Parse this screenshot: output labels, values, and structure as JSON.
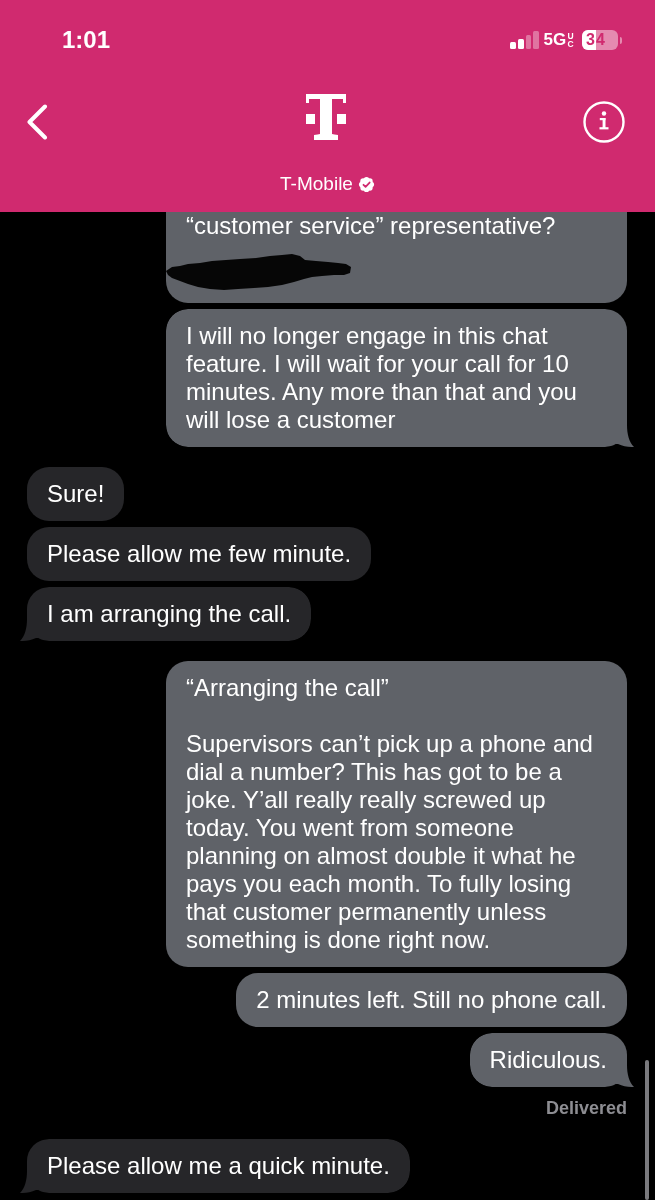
{
  "status_bar": {
    "time": "1:01",
    "network": "5G",
    "network_badge": "UC",
    "battery": "34"
  },
  "header": {
    "contact_name": "T-Mobile",
    "verified": true
  },
  "messages": [
    {
      "kind": "sent",
      "text": "“customer service” representative?",
      "redacted": true,
      "tail": false
    },
    {
      "kind": "sent",
      "text": "I will no longer engage in this chat feature. I will wait for your call for 10 minutes. Any more than that and you will lose a customer",
      "redacted": false,
      "tail": true
    },
    {
      "kind": "received",
      "text": "Sure!",
      "redacted": false,
      "tail": false
    },
    {
      "kind": "received",
      "text": "Please allow me few minute.",
      "redacted": false,
      "tail": false
    },
    {
      "kind": "received",
      "text": "I am arranging the call.",
      "redacted": false,
      "tail": true
    },
    {
      "kind": "sent",
      "text": "“Arranging the call”\n\nSupervisors can’t pick up a phone and dial a number? This has got to be a joke. Y’all really really screwed up today. You went from someone planning on almost double it what he pays you each month. To fully losing that customer permanently unless something is done right now.",
      "redacted": false,
      "tail": false
    },
    {
      "kind": "sent",
      "text": "2 minutes left. Still no phone call.",
      "redacted": false,
      "tail": false
    },
    {
      "kind": "sent",
      "text": "Ridiculous.",
      "redacted": false,
      "tail": true,
      "status": "Delivered"
    },
    {
      "kind": "received",
      "text": "Please allow me a quick minute.",
      "redacted": false,
      "tail": true
    }
  ]
}
